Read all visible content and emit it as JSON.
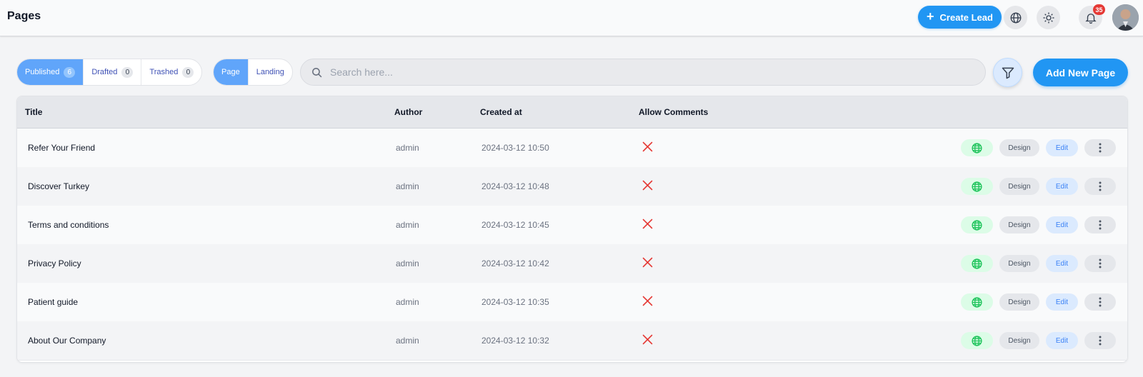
{
  "header": {
    "title": "Pages",
    "create_lead_label": "Create Lead",
    "notifications_count": "35",
    "icons": [
      "plus-icon",
      "globe-icon",
      "sun-icon",
      "bell-icon"
    ]
  },
  "status_tabs": [
    {
      "label": "Published",
      "count": "6",
      "active": true
    },
    {
      "label": "Drafted",
      "count": "0",
      "active": false
    },
    {
      "label": "Trashed",
      "count": "0",
      "active": false
    }
  ],
  "type_tabs": [
    {
      "label": "Page",
      "active": true
    },
    {
      "label": "Landing",
      "active": false
    }
  ],
  "search": {
    "placeholder": "Search here..."
  },
  "add_page_label": "Add New Page",
  "table": {
    "columns": [
      "Title",
      "Author",
      "Created at",
      "Allow Comments"
    ],
    "rows": [
      {
        "title": "Refer Your Friend",
        "author": "admin",
        "created_at": "2024-03-12 10:50",
        "allow_comments": false
      },
      {
        "title": "Discover Turkey",
        "author": "admin",
        "created_at": "2024-03-12 10:48",
        "allow_comments": false
      },
      {
        "title": "Terms and conditions",
        "author": "admin",
        "created_at": "2024-03-12 10:45",
        "allow_comments": false
      },
      {
        "title": "Privacy Policy",
        "author": "admin",
        "created_at": "2024-03-12 10:42",
        "allow_comments": false
      },
      {
        "title": "Patient guide",
        "author": "admin",
        "created_at": "2024-03-12 10:35",
        "allow_comments": false
      },
      {
        "title": "About Our Company",
        "author": "admin",
        "created_at": "2024-03-12 10:32",
        "allow_comments": false
      }
    ],
    "actions": {
      "design_label": "Design",
      "edit_label": "Edit"
    }
  },
  "colors": {
    "primary": "#2196f3",
    "active_tab": "#60a5fa",
    "danger_x": "#e53935",
    "globe_green": "#22c55e",
    "badge_red": "#e53935"
  }
}
